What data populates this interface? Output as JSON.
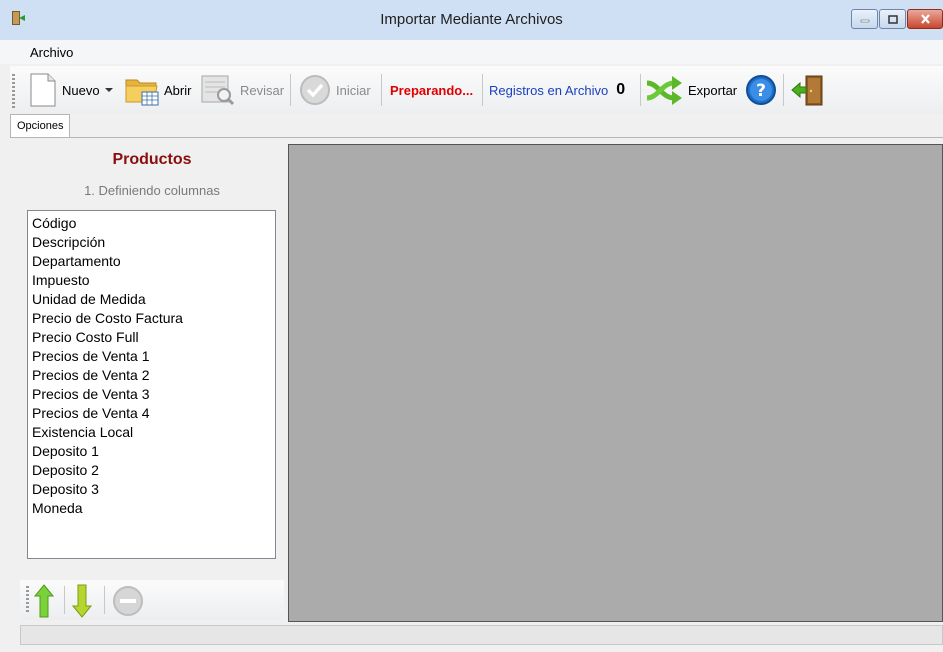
{
  "window": {
    "title": "Importar Mediante Archivos"
  },
  "menu": {
    "items": [
      "Archivo"
    ]
  },
  "toolbar": {
    "nuevo": "Nuevo",
    "abrir": "Abrir",
    "revisar": "Revisar",
    "iniciar": "Iniciar",
    "status": "Preparando...",
    "registros_label": "Registros en Archivo",
    "registros_count": "0",
    "exportar": "Exportar"
  },
  "tabs": [
    "Opciones"
  ],
  "panel": {
    "title": "Productos",
    "subtitle": "1. Definiendo columnas",
    "columns": [
      "Código",
      "Descripción",
      "Departamento",
      "Impuesto",
      "Unidad de Medida",
      "Precio de Costo Factura",
      "Precio Costo Full",
      "Precios de Venta 1",
      "Precios de Venta 2",
      "Precios de Venta 3",
      "Precios de Venta 4",
      "Existencia Local",
      "Deposito 1",
      "Deposito 2",
      "Deposito 3",
      "Moneda"
    ]
  },
  "colors": {
    "title_red": "#8b0e0e",
    "status_red": "#e00000",
    "status_blue": "#1a3fc0",
    "preview_gray": "#ababab"
  },
  "icons": [
    "app-icon",
    "document-new-icon",
    "folder-open-icon",
    "review-icon",
    "check-circle-icon",
    "shuffle-export-icon",
    "help-icon",
    "exit-door-icon",
    "arrow-up-icon",
    "arrow-down-icon",
    "remove-icon"
  ]
}
